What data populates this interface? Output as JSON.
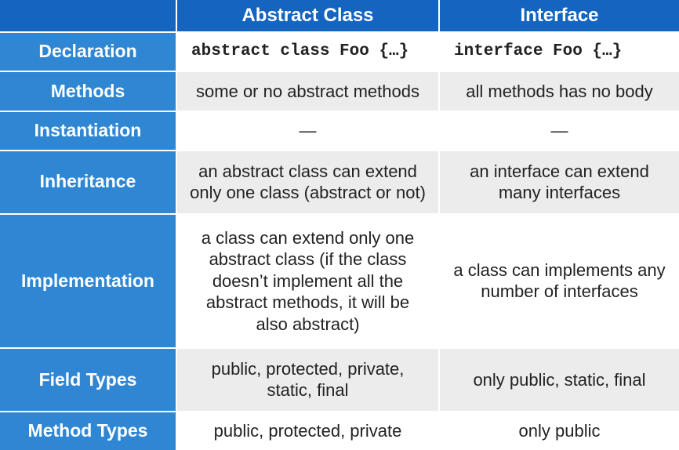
{
  "table": {
    "columns": {
      "col1": "Abstract Class",
      "col2": "Interface"
    },
    "rows": {
      "declaration": {
        "label": "Declaration",
        "col1": "abstract class Foo {…}",
        "col2": "interface Foo {…}"
      },
      "methods": {
        "label": "Methods",
        "col1": "some or no abstract methods",
        "col2": "all methods has no body"
      },
      "instantiation": {
        "label": "Instantiation",
        "col1": "—",
        "col2": "—"
      },
      "inheritance": {
        "label": "Inheritance",
        "col1": "an abstract class can extend only one class\n(abstract or not)",
        "col2": "an interface can extend many interfaces"
      },
      "implementation": {
        "label": "Implementation",
        "col1": "a class can extend only one abstract class (if the class doesn’t implement all the abstract methods, it will be also abstract)",
        "col2": "a class can implements any number of interfaces"
      },
      "field_types": {
        "label": "Field Types",
        "col1": "public, protected, private, static, final",
        "col2": "only public, static, final"
      },
      "method_types": {
        "label": "Method Types",
        "col1": "public, protected, private",
        "col2": "only public"
      }
    }
  }
}
